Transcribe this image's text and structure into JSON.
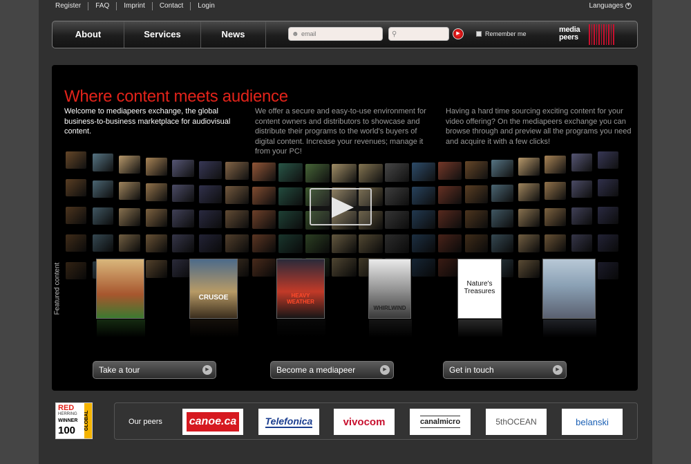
{
  "topnav": [
    "Register",
    "FAQ",
    "Imprint",
    "Contact",
    "Login"
  ],
  "languages_label": "Languages",
  "menu": {
    "about": "About",
    "services": "Services",
    "news": "News"
  },
  "login": {
    "email_placeholder": "email",
    "password_placeholder": "",
    "remember_label": "Remember me"
  },
  "logo": {
    "line1": "media",
    "line2": "peers"
  },
  "hero": {
    "title": "Where content meets audience",
    "col1": "Welcome to mediapeers exchange, the global business-to-business marketplace for audiovisual content.",
    "col2": "We offer a secure and easy-to-use environment for content owners and distributors to showcase and distribute their programs to the world's buyers of digital content. Increase your revenues; manage it from your PC!",
    "col3": "Having a hard time sourcing exciting content for your video offering? On the mediapeers exchange you can browse through and preview all the programs you need and acquire it with a few clicks!",
    "featured_label": "Featured content"
  },
  "posters": [
    {
      "title": ""
    },
    {
      "title": "CRUSOE"
    },
    {
      "title": "HEAVY WEATHER"
    },
    {
      "title": "WHIRLWIND"
    },
    {
      "title": "Nature's Treasures"
    },
    {
      "title": ""
    }
  ],
  "buttons": {
    "tour": "Take a tour",
    "become": "Become a mediapeer",
    "contact": "Get in touch"
  },
  "award": {
    "line1": "RED",
    "line2": "HERRING",
    "line3": "WINNER",
    "line4": "100",
    "side": "GLOBAL"
  },
  "peers": {
    "label": "Our peers",
    "logos": [
      "canoe.ca",
      "Telefonica",
      "vivocom",
      "canalmicro",
      "5thOCEAN",
      "belanski"
    ]
  },
  "colors": {
    "accent_red": "#e2231a",
    "background": "#303030",
    "hero_bg": "#000000"
  }
}
